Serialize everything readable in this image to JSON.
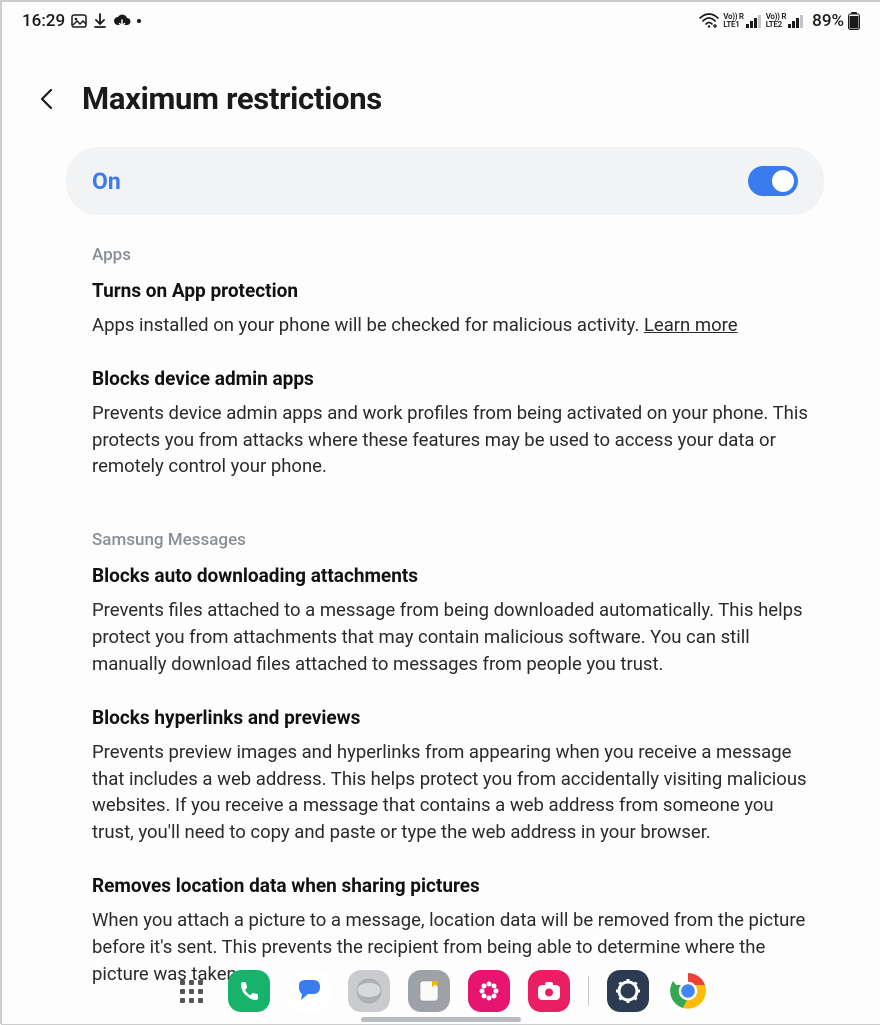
{
  "status_bar": {
    "time": "16:29",
    "battery_percent": "89%",
    "sim1": "LTE1",
    "sim2": "LTE2",
    "vo_label": "Vo)) R"
  },
  "header": {
    "title": "Maximum restrictions"
  },
  "toggle": {
    "label": "On",
    "state": "on"
  },
  "sections": [
    {
      "label": "Apps",
      "items": [
        {
          "title": "Turns on App protection",
          "desc": "Apps installed on your phone will be checked for malicious activity. ",
          "link": "Learn more"
        },
        {
          "title": "Blocks device admin apps",
          "desc": "Prevents device admin apps and work profiles from being activated on your phone. This protects you from attacks where these features may be used to access your data or remotely control your phone."
        }
      ]
    },
    {
      "label": "Samsung Messages",
      "items": [
        {
          "title": "Blocks auto downloading attachments",
          "desc": "Prevents files attached to a message from being downloaded automatically. This helps protect you from attachments that may contain malicious software. You can still manually download files attached to messages from people you trust."
        },
        {
          "title": "Blocks hyperlinks and previews",
          "desc": "Prevents preview images and hyperlinks from appearing when you receive a message that includes a web address. This helps protect you from accidentally visiting malicious websites. If you receive a message that contains a web address from someone you trust, you'll need to copy and paste or type the web address in your browser."
        },
        {
          "title": "Removes location data when sharing pictures",
          "desc": "When you attach a picture to a message, location data will be removed from the picture before it's sent. This prevents the recipient from being able to determine where the picture was taken."
        }
      ]
    }
  ],
  "dock": {
    "apps": "Apps",
    "phone": "Phone",
    "messages": "Messages",
    "internet": "Internet",
    "notes": "Notes",
    "gallery": "Gallery",
    "camera": "Camera",
    "settings": "Settings",
    "chrome": "Chrome"
  }
}
